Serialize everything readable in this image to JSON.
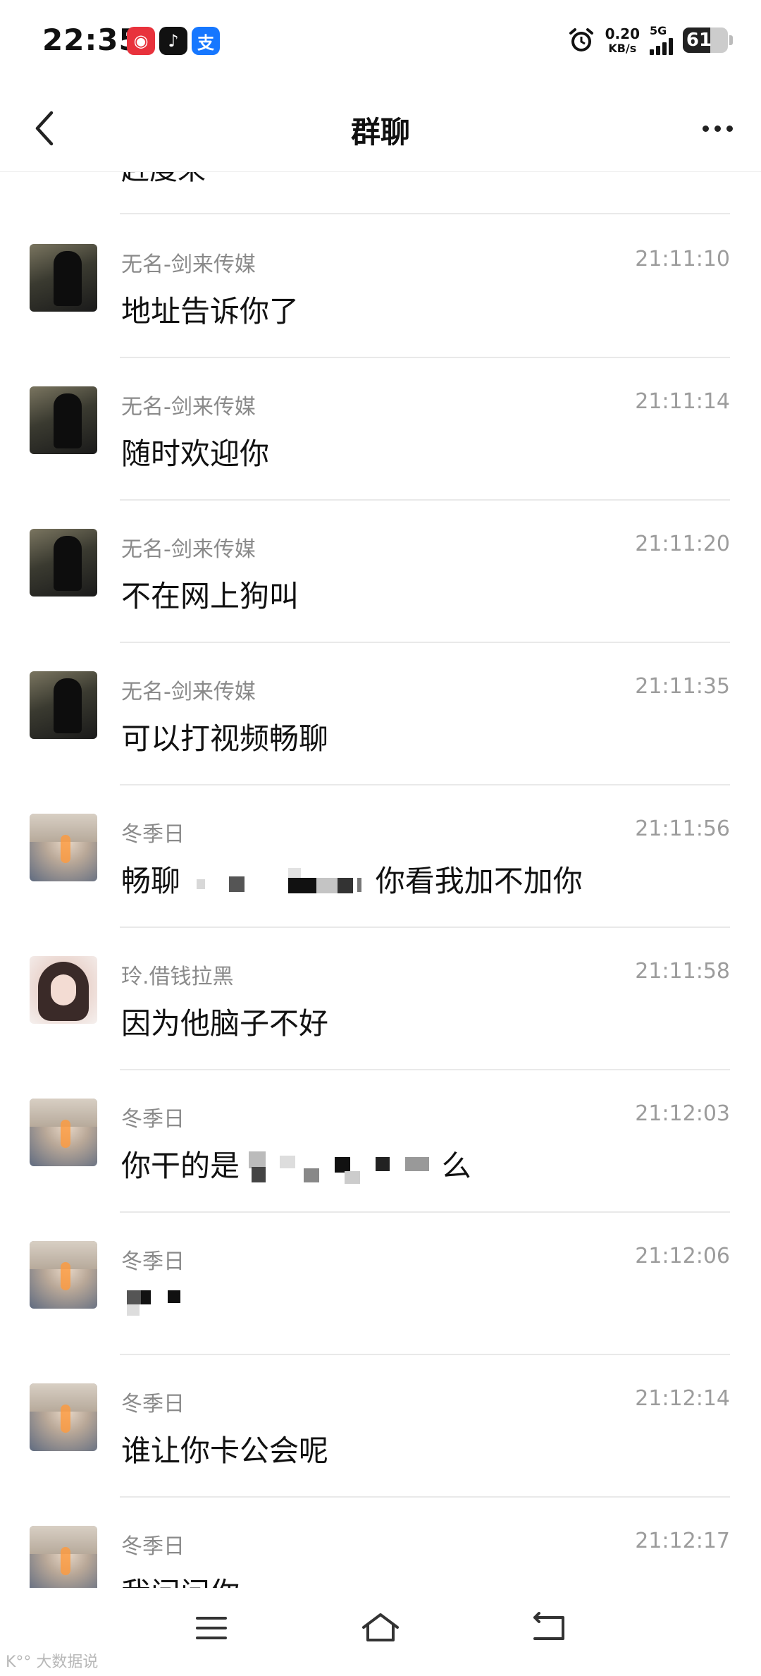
{
  "status_bar": {
    "time": "22:35",
    "app_icons": [
      {
        "name": "netease-music-icon",
        "glyph": "◉"
      },
      {
        "name": "tiktok-icon",
        "glyph": "♪"
      },
      {
        "name": "alipay-icon",
        "glyph": "支"
      }
    ],
    "net_speed_value": "0.20",
    "net_speed_unit": "KB/s",
    "network_type": "5G",
    "battery": "61",
    "battery_level": 0.61
  },
  "header": {
    "title": "群聊"
  },
  "partial_top_text": "赶度来",
  "messages": [
    {
      "sender": "无名-剑来传媒",
      "time": "21:11:10",
      "text": "地址告诉你了",
      "avatar": "dark"
    },
    {
      "sender": "无名-剑来传媒",
      "time": "21:11:14",
      "text": "随时欢迎你",
      "avatar": "dark"
    },
    {
      "sender": "无名-剑来传媒",
      "time": "21:11:20",
      "text": "不在网上狗叫",
      "avatar": "dark"
    },
    {
      "sender": "无名-剑来传媒",
      "time": "21:11:35",
      "text": "可以打视频畅聊",
      "avatar": "dark"
    },
    {
      "sender": "冬季日",
      "time": "21:11:56",
      "text_before": "畅聊",
      "text_after": "你看我加不加你",
      "avatar": "light"
    },
    {
      "sender": "玲.借钱拉黑",
      "time": "21:11:58",
      "text": "因为他脑子不好",
      "avatar": "girl"
    },
    {
      "sender": "冬季日",
      "time": "21:12:03",
      "text_before": "你干的是",
      "text_after": "么",
      "avatar": "light"
    },
    {
      "sender": "冬季日",
      "time": "21:12:06",
      "text": "",
      "avatar": "light"
    },
    {
      "sender": "冬季日",
      "time": "21:12:14",
      "text": "谁让你卡公会呢",
      "avatar": "light"
    },
    {
      "sender": "冬季日",
      "time": "21:12:17",
      "text": "我问问你",
      "avatar": "light"
    }
  ],
  "nav": {
    "menu": "menu-icon",
    "home": "home-icon",
    "back": "back-icon"
  },
  "watermark": "K°° 大数据说"
}
